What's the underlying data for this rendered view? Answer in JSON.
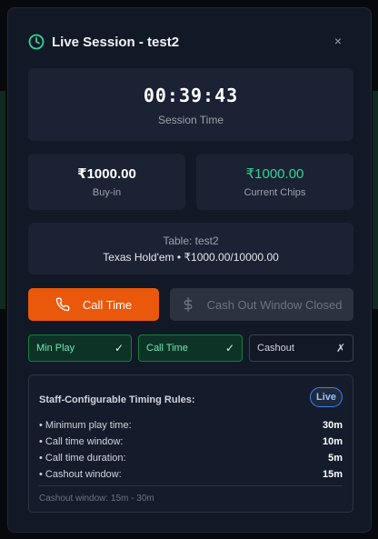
{
  "colors": {
    "accent_orange": "#ea580c",
    "success_green": "#34d399",
    "modal_bg": "#111826",
    "card_bg": "#1a2233",
    "badge_blue": "#3b82f6"
  },
  "backdrop": {
    "close_glyph": "✕"
  },
  "modal": {
    "title": "Live Session - test2",
    "title_icon": "clock-icon",
    "close_glyph": "×"
  },
  "timer": {
    "value": "00:39:43",
    "label": "Session Time"
  },
  "buyin": {
    "value": "₹1000.00",
    "label": "Buy-in"
  },
  "chips": {
    "value": "₹1000.00",
    "label": "Current Chips"
  },
  "table": {
    "name": "Table: test2",
    "game": "Texas Hold'em • ₹1000.00/10000.00"
  },
  "actions": {
    "call_time": {
      "label": "Call Time",
      "icon": "phone-icon"
    },
    "cashout": {
      "label": "Cash Out Window Closed",
      "icon": "dollar-icon",
      "disabled": true
    }
  },
  "status": {
    "min_play": {
      "label": "Min Play",
      "mark": "✓",
      "state": "done"
    },
    "call_time": {
      "label": "Call Time",
      "mark": "✓",
      "state": "done"
    },
    "cashout": {
      "label": "Cashout",
      "mark": "✗",
      "state": "pending"
    }
  },
  "rules": {
    "title": "Staff-Configurable Timing Rules:",
    "badge": "Live",
    "items": [
      {
        "label": "• Minimum play time:",
        "value": "30m"
      },
      {
        "label": "• Call time window:",
        "value": "10m"
      },
      {
        "label": "• Call time duration:",
        "value": "5m"
      },
      {
        "label": "• Cashout window:",
        "value": "15m"
      }
    ],
    "footer": "Cashout window: 15m - 30m"
  }
}
